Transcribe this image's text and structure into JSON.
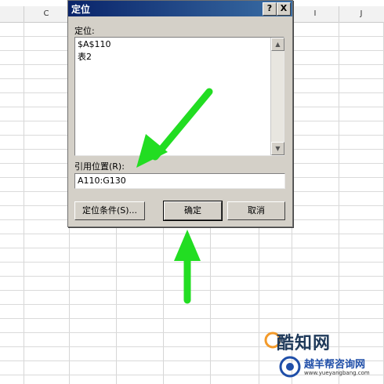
{
  "sheet": {
    "columns": {
      "c": "C",
      "i": "I",
      "j": "J"
    }
  },
  "dialog": {
    "title": "定位",
    "help_label": "?",
    "close_label": "X",
    "goto_label": "定位:",
    "list_items": [
      "$A$110",
      "表2"
    ],
    "scroll_up": "▲",
    "scroll_down": "▼",
    "reference_label": "引用位置(R):",
    "reference_value": "A110:G130",
    "special_button": "定位条件(S)...",
    "ok_button": "确定",
    "cancel_button": "取消"
  },
  "watermark": {
    "brand": "酷知网",
    "sub": "越羊帮咨询网",
    "url": "www.yueyangbang.com"
  },
  "colors": {
    "arrow": "#22dd22",
    "titlebar": "#0a246a",
    "dialog_bg": "#d4d0c8"
  }
}
